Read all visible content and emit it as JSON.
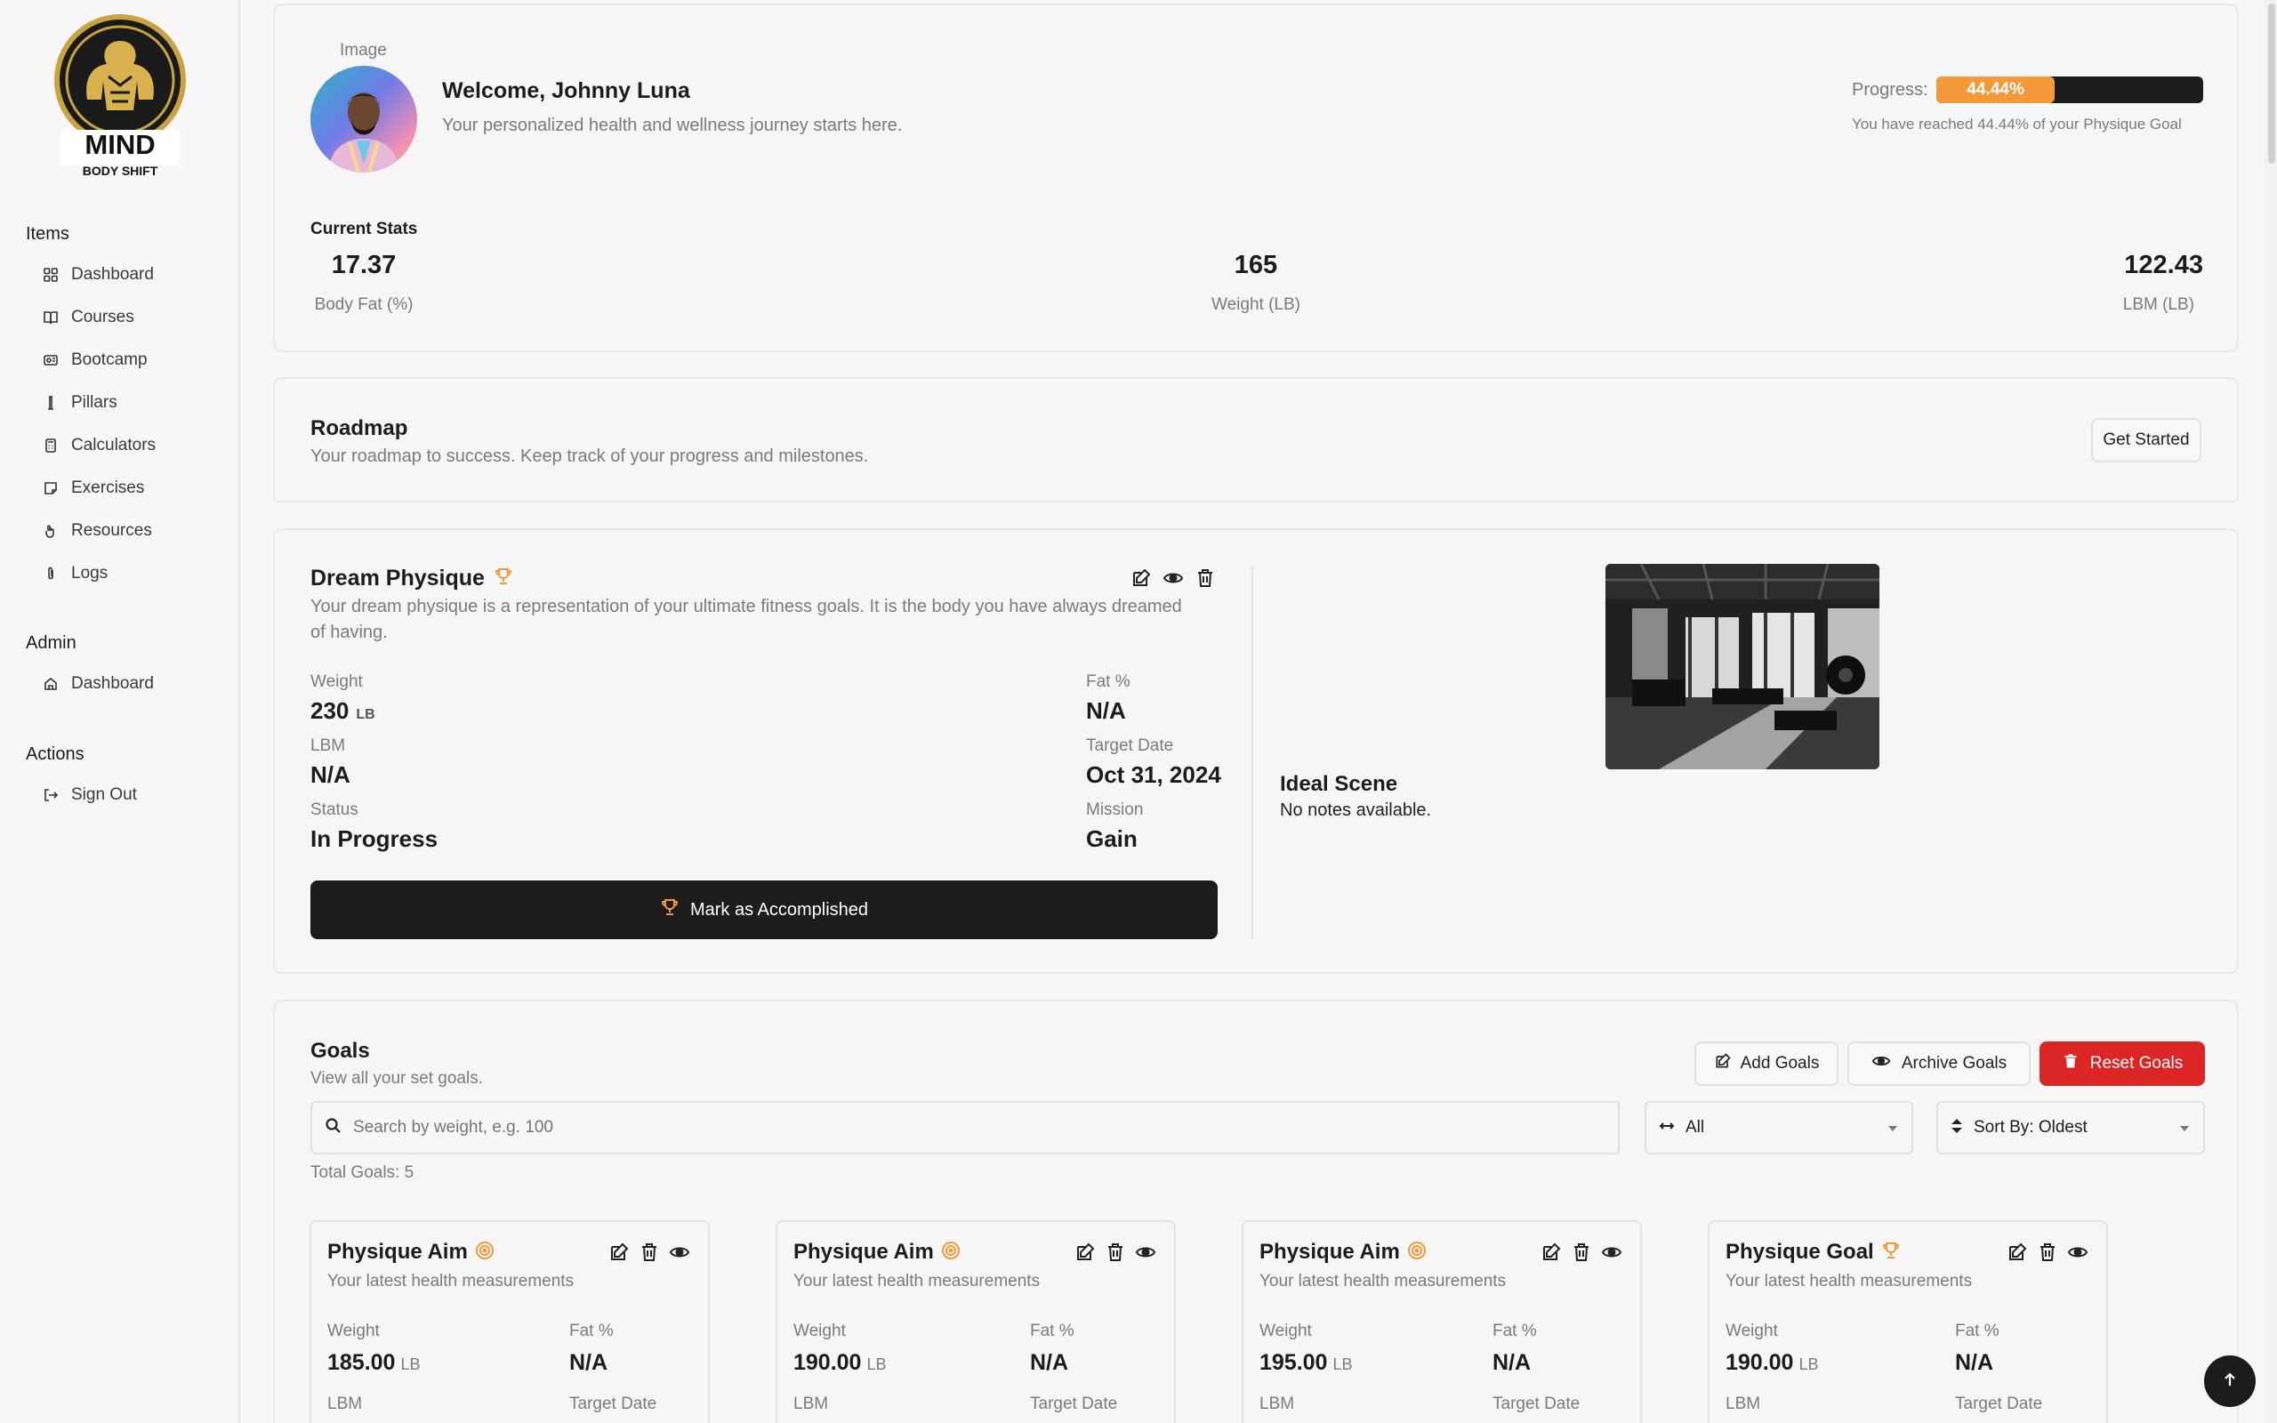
{
  "brand": {
    "line1": "MIND",
    "line2": "BODY SHIFT"
  },
  "sidebar": {
    "items_heading": "Items",
    "items": [
      {
        "label": "Dashboard",
        "icon": "grid-icon"
      },
      {
        "label": "Courses",
        "icon": "book-icon"
      },
      {
        "label": "Bootcamp",
        "icon": "bootcamp-icon"
      },
      {
        "label": "Pillars",
        "icon": "pillar-icon"
      },
      {
        "label": "Calculators",
        "icon": "calculator-icon"
      },
      {
        "label": "Exercises",
        "icon": "note-icon"
      },
      {
        "label": "Resources",
        "icon": "hand-icon"
      },
      {
        "label": "Logs",
        "icon": "paperclip-icon"
      }
    ],
    "admin_heading": "Admin",
    "admin_items": [
      {
        "label": "Dashboard",
        "icon": "home-icon"
      }
    ],
    "actions_heading": "Actions",
    "actions_items": [
      {
        "label": "Sign Out",
        "icon": "sign-out-icon"
      }
    ]
  },
  "profile": {
    "image_label": "Image",
    "welcome": "Welcome, Johnny Luna",
    "subtitle": "Your personalized health and wellness journey starts here.",
    "progress_label": "Progress:",
    "progress_value": 44.44,
    "progress_text": "44.44%",
    "progress_note": "You have reached 44.44% of your Physique Goal",
    "stats_heading": "Current Stats",
    "stats": [
      {
        "value": "17.37",
        "label": "Body Fat (%)"
      },
      {
        "value": "165",
        "label": "Weight (LB)"
      },
      {
        "value": "122.43",
        "label": "LBM (LB)"
      }
    ]
  },
  "roadmap": {
    "title": "Roadmap",
    "subtitle": "Your roadmap to success. Keep track of your progress and milestones.",
    "button": "Get Started"
  },
  "dream": {
    "title": "Dream Physique",
    "description": "Your dream physique is a representation of your ultimate fitness goals. It is the body you have always dreamed of having.",
    "weight_label": "Weight",
    "weight_value": "230",
    "weight_unit": "LB",
    "fat_label": "Fat %",
    "fat_value": "N/A",
    "lbm_label": "LBM",
    "lbm_value": "N/A",
    "target_label": "Target Date",
    "target_value": "Oct 31, 2024",
    "status_label": "Status",
    "status_value": "In Progress",
    "mission_label": "Mission",
    "mission_value": "Gain",
    "button": "Mark as Accomplished",
    "scene_title": "Ideal Scene",
    "scene_notes": "No notes available."
  },
  "goals": {
    "title": "Goals",
    "subtitle": "View all your set goals.",
    "add": "Add Goals",
    "archive": "Archive Goals",
    "reset": "Reset Goals",
    "search_placeholder": "Search by weight, e.g. 100",
    "filter_value": "All",
    "sort_value": "Sort By: Oldest",
    "total": "Total Goals: 5",
    "cards": [
      {
        "title": "Physique Aim",
        "icon": "target-icon",
        "subtitle": "Your latest health measurements",
        "weight_label": "Weight",
        "weight": "185.00",
        "unit": "LB",
        "fat_label": "Fat %",
        "fat": "N/A",
        "lbm_label": "LBM",
        "target_label": "Target Date"
      },
      {
        "title": "Physique Aim",
        "icon": "target-icon",
        "subtitle": "Your latest health measurements",
        "weight_label": "Weight",
        "weight": "190.00",
        "unit": "LB",
        "fat_label": "Fat %",
        "fat": "N/A",
        "lbm_label": "LBM",
        "target_label": "Target Date"
      },
      {
        "title": "Physique Aim",
        "icon": "target-icon",
        "subtitle": "Your latest health measurements",
        "weight_label": "Weight",
        "weight": "195.00",
        "unit": "LB",
        "fat_label": "Fat %",
        "fat": "N/A",
        "lbm_label": "LBM",
        "target_label": "Target Date"
      },
      {
        "title": "Physique Goal",
        "icon": "trophy-icon",
        "subtitle": "Your latest health measurements",
        "weight_label": "Weight",
        "weight": "190.00",
        "unit": "LB",
        "fat_label": "Fat %",
        "fat": "N/A",
        "lbm_label": "LBM",
        "target_label": "Target Date"
      }
    ]
  },
  "colors": {
    "accent": "#f4993a",
    "dark": "#1c1c1c",
    "danger": "#dc2626"
  }
}
